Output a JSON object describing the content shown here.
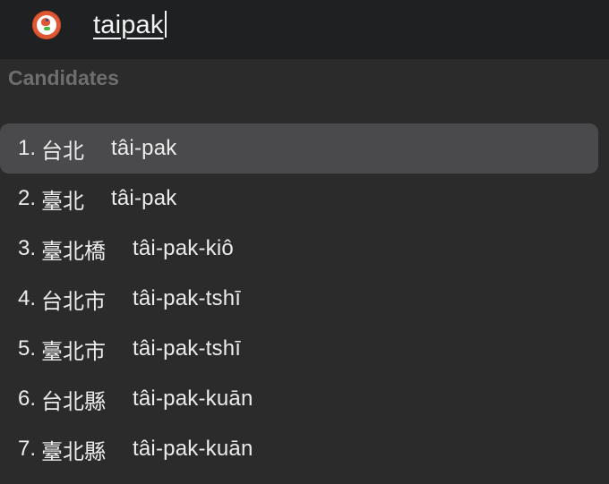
{
  "search": {
    "query": "taipak"
  },
  "section": {
    "title": "Candidates"
  },
  "candidates": [
    {
      "num": "1.",
      "han": "台北",
      "rom": "tâi-pak",
      "selected": true
    },
    {
      "num": "2.",
      "han": "臺北",
      "rom": "tâi-pak",
      "selected": false
    },
    {
      "num": "3.",
      "han": "臺北橋",
      "rom": "tâi-pak-kiô",
      "selected": false
    },
    {
      "num": "4.",
      "han": "台北市",
      "rom": "tâi-pak-tshī",
      "selected": false
    },
    {
      "num": "5.",
      "han": "臺北市",
      "rom": "tâi-pak-tshī",
      "selected": false
    },
    {
      "num": "6.",
      "han": "台北縣",
      "rom": "tâi-pak-kuān",
      "selected": false
    },
    {
      "num": "7.",
      "han": "臺北縣",
      "rom": "tâi-pak-kuān",
      "selected": false
    }
  ],
  "icons": {
    "app": "duckduckgo-logo-icon"
  },
  "colors": {
    "background": "#2b2b2b",
    "topbar": "#1f2022",
    "selected_row": "#4a4a4c",
    "section_title": "#6e6e6e",
    "brand": "#de5833"
  }
}
